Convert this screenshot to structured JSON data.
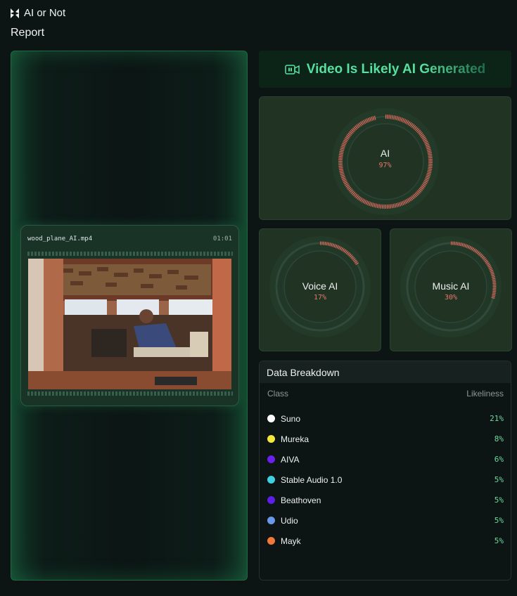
{
  "app": {
    "name": "AI or Not",
    "logo_icon": "butterfly-logo-icon"
  },
  "page": {
    "title": "Report"
  },
  "media": {
    "file_name": "wood_plane_AI.mp4",
    "duration": "01:01",
    "thumbnail_icon": "video-frame-image"
  },
  "verdict": {
    "icon": "video-camera-icon",
    "text": "Video Is Likely AI Generated",
    "color": "#58e0a0"
  },
  "gauges": {
    "ai": {
      "label": "AI",
      "value_text": "97%",
      "value": 0.97
    },
    "voice": {
      "label": "Voice AI",
      "value_text": "17%",
      "value": 0.17
    },
    "music": {
      "label": "Music AI",
      "value_text": "30%",
      "value": 0.3
    },
    "arc_color": "#e0675c",
    "track_color": "#2f4a38"
  },
  "breakdown": {
    "title": "Data Breakdown",
    "columns": {
      "class": "Class",
      "likeliness": "Likeliness"
    },
    "rows": [
      {
        "name": "Suno",
        "value": "21%",
        "color": "#ffffff"
      },
      {
        "name": "Mureka",
        "value": "8%",
        "color": "#f5e63a"
      },
      {
        "name": "AIVA",
        "value": "6%",
        "color": "#6b1ff0"
      },
      {
        "name": "Stable Audio 1.0",
        "value": "5%",
        "color": "#3fd0e0"
      },
      {
        "name": "Beathoven",
        "value": "5%",
        "color": "#5b1fe8"
      },
      {
        "name": "Udio",
        "value": "5%",
        "color": "#6a98e8"
      },
      {
        "name": "Mayk",
        "value": "5%",
        "color": "#f07838"
      }
    ]
  }
}
